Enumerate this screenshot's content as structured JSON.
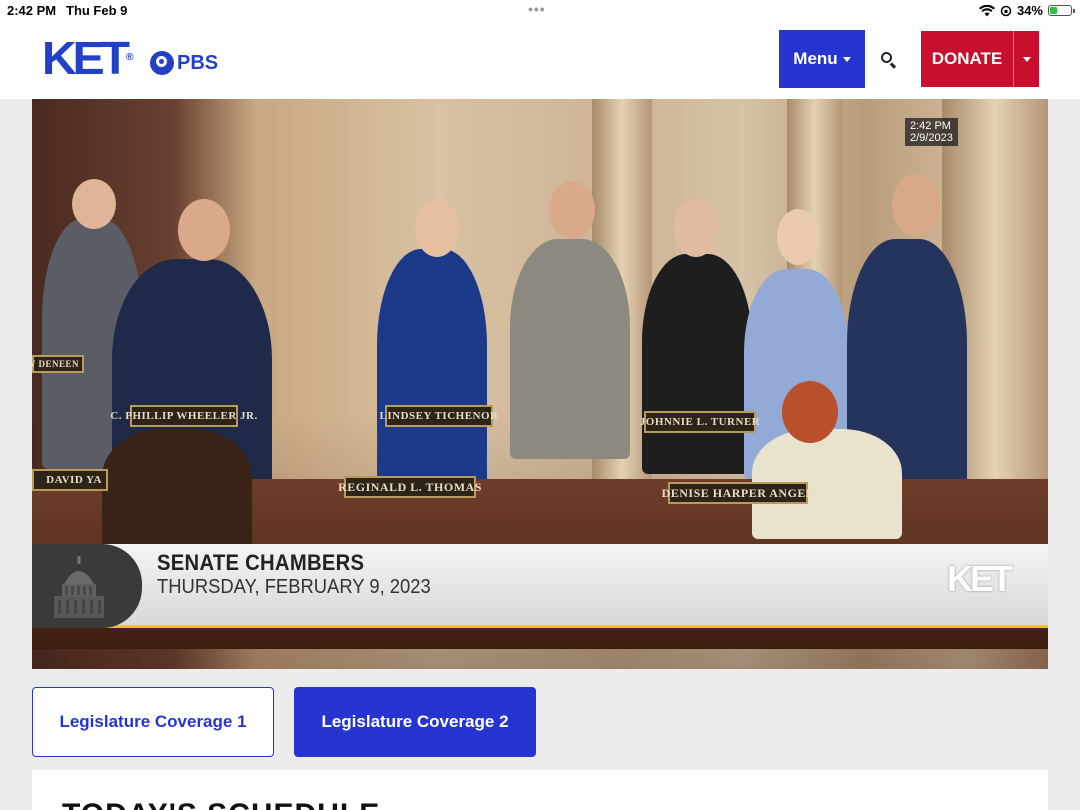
{
  "status_bar": {
    "time": "2:42 PM",
    "date": "Thu Feb 9",
    "battery": "34%",
    "battery_level": 0.34
  },
  "header": {
    "logo_text": "KET",
    "partner_logo_text": "PBS",
    "menu_label": "Menu",
    "donate_label": "DONATE",
    "colors": {
      "brand_blue": "#2735d0",
      "donate_red": "#c8102e"
    }
  },
  "video": {
    "timestamp_time": "2:42 PM",
    "timestamp_date": "2/9/2023",
    "nameplates": [
      "C. PHILLIP WHEELER JR.",
      "LINDSEY TICHENOR",
      "JOHNNIE L. TURNER",
      "REGINALD L. THOMAS",
      "DENISE HARPER ANGEL",
      "DAVID YA",
      "EW DENEEN"
    ],
    "lower_third_title": "SENATE CHAMBERS",
    "lower_third_subtitle": "THURSDAY, FEBRUARY 9, 2023",
    "lower_third_logo": "KET"
  },
  "tabs": [
    {
      "label": "Legislature Coverage 1",
      "active": false
    },
    {
      "label": "Legislature Coverage 2",
      "active": true
    }
  ],
  "schedule": {
    "heading": "TODAY'S SCHEDULE"
  }
}
